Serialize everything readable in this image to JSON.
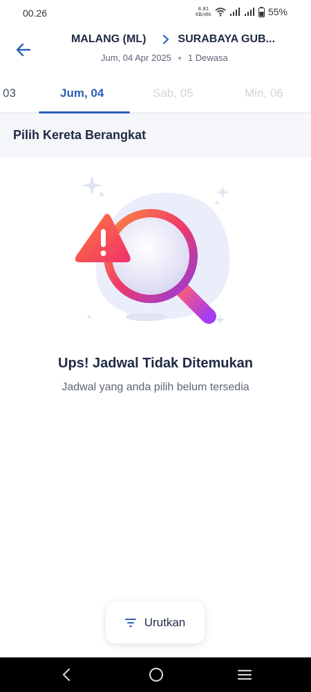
{
  "status_bar": {
    "time": "00.26",
    "net_speed_value": "8.81",
    "net_speed_unit": "KB/dtk",
    "battery": "55%"
  },
  "header": {
    "origin": "MALANG (ML)",
    "destination": "SURABAYA GUB...",
    "date": "Jum, 04 Apr 2025",
    "passengers": "1 Dewasa"
  },
  "date_tabs": [
    {
      "label": "03",
      "state": "previous"
    },
    {
      "label": "Jum, 04",
      "state": "active"
    },
    {
      "label": "Sab, 05",
      "state": "inactive"
    },
    {
      "label": "Min, 06",
      "state": "inactive"
    }
  ],
  "section": {
    "title": "Pilih Kereta Berangkat"
  },
  "empty_state": {
    "title": "Ups! Jadwal Tidak Ditemukan",
    "description": "Jadwal yang anda pilih belum tersedia"
  },
  "sort_button": {
    "label": "Urutkan"
  },
  "colors": {
    "accent": "#2b5fb8",
    "text_dark": "#1f2a44",
    "text_muted": "#5d6478",
    "warning_gradient_start": "#ff7a3d",
    "warning_gradient_end": "#f0306a"
  }
}
